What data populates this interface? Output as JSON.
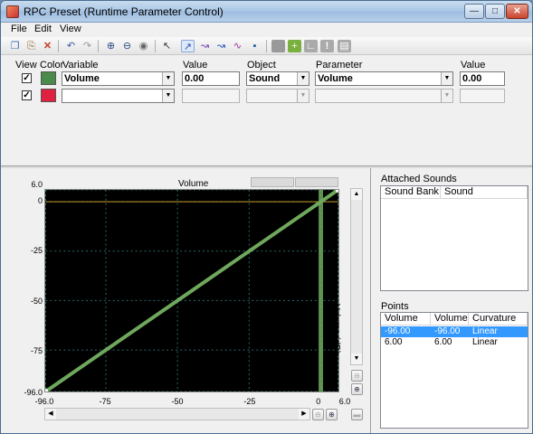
{
  "window": {
    "title": "RPC Preset (Runtime Parameter Control)"
  },
  "menu": [
    "File",
    "Edit",
    "View"
  ],
  "columns": {
    "view": "View",
    "color": "Color",
    "variable": "Variable",
    "value": "Value",
    "object": "Object",
    "parameter": "Parameter",
    "param_value": "Value"
  },
  "rows": [
    {
      "checked": true,
      "color": "#4a8a4a",
      "variable": "Volume",
      "value": "0.00",
      "object": "Sound",
      "parameter": "Volume",
      "param_value": "0.00",
      "enabled": true
    },
    {
      "checked": true,
      "color": "#e02040",
      "variable": "",
      "value": "",
      "object": "",
      "parameter": "",
      "param_value": "",
      "enabled": false
    }
  ],
  "graph": {
    "title": "Volume",
    "y_axis_title": "Volume (dB)",
    "y_ticks": [
      "6.0",
      "0",
      "-25",
      "-50",
      "-75",
      "-96.0"
    ],
    "x_ticks": [
      "-96.0",
      "-75",
      "-50",
      "-25",
      "0",
      "6.0"
    ],
    "line_color": "#6fa85c",
    "grid_color": "#2a6a6a",
    "zero_line_color": "#c89a2a",
    "cursor_value": 0
  },
  "attached_sounds": {
    "title": "Attached Sounds",
    "headers": [
      "Sound Bank",
      "Sound"
    ]
  },
  "points": {
    "title": "Points",
    "headers": [
      "Volume",
      "Volume",
      "Curvature"
    ],
    "rows": [
      [
        "-96.00",
        "-96.00",
        "Linear"
      ],
      [
        "6.00",
        "6.00",
        "Linear"
      ]
    ]
  },
  "chart_data": {
    "type": "line",
    "series": [
      {
        "x": [
          -96.0,
          6.0
        ],
        "y": [
          -96.0,
          6.0
        ]
      }
    ],
    "xlim": [
      -96.0,
      6.0
    ],
    "ylim": [
      -96.0,
      6.0
    ],
    "title": "Volume",
    "ylabel": "Volume (dB)",
    "x_ticks": [
      -96.0,
      -75,
      -50,
      -25,
      0,
      6.0
    ],
    "y_ticks": [
      6.0,
      0,
      -25,
      -50,
      -75,
      -96.0
    ],
    "grid": true
  }
}
